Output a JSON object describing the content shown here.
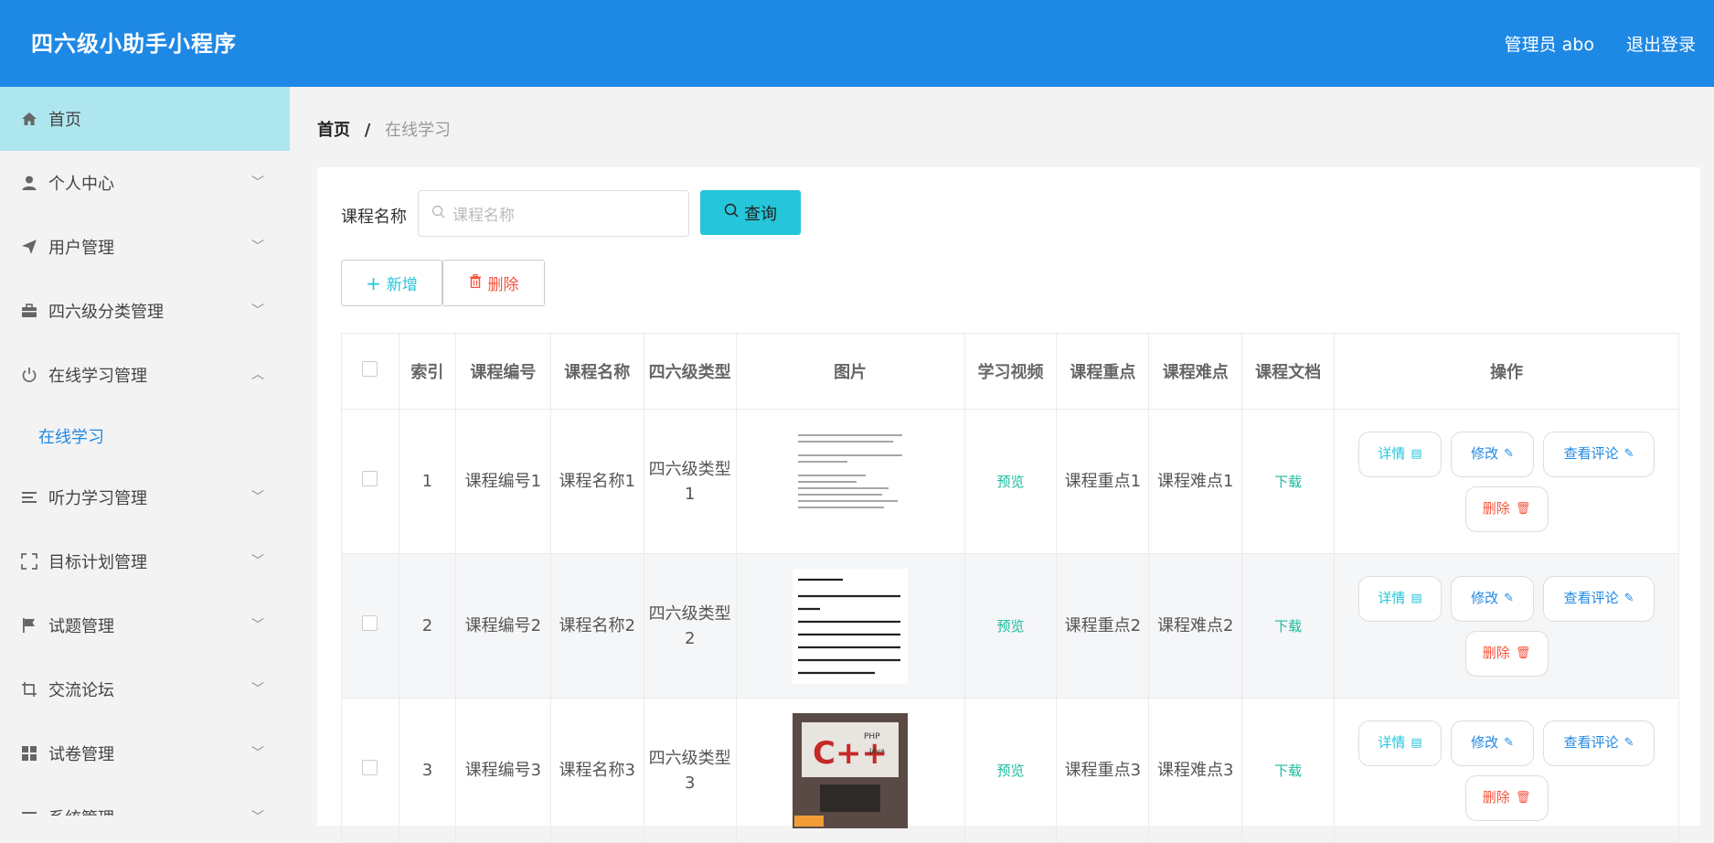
{
  "header": {
    "title": "四六级小助手小程序",
    "user": "管理员 abo",
    "logout": "退出登录"
  },
  "sidebar": {
    "items": [
      {
        "label": "首页",
        "icon": "home-icon"
      },
      {
        "label": "个人中心",
        "icon": "user-icon"
      },
      {
        "label": "用户管理",
        "icon": "send-icon"
      },
      {
        "label": "四六级分类管理",
        "icon": "briefcase-icon"
      },
      {
        "label": "在线学习管理",
        "icon": "power-icon"
      },
      {
        "label": "听力学习管理",
        "icon": "list-icon"
      },
      {
        "label": "目标计划管理",
        "icon": "fullscreen-icon"
      },
      {
        "label": "试题管理",
        "icon": "flag-icon"
      },
      {
        "label": "交流论坛",
        "icon": "crop-icon"
      },
      {
        "label": "试卷管理",
        "icon": "grid-icon"
      },
      {
        "label": "系统管理",
        "icon": "settings-icon"
      }
    ],
    "sub_online": "在线学习"
  },
  "breadcrumb": {
    "home": "首页",
    "sep": "/",
    "current": "在线学习"
  },
  "search": {
    "label": "课程名称",
    "placeholder": "课程名称",
    "button": "查询"
  },
  "actions": {
    "add": "新增",
    "delete": "删除"
  },
  "table": {
    "headers": [
      "索引",
      "课程编号",
      "课程名称",
      "四六级类型",
      "图片",
      "学习视频",
      "课程重点",
      "课程难点",
      "课程文档",
      "操作"
    ],
    "rows": [
      {
        "index": "1",
        "code": "课程编号1",
        "name": "课程名称1",
        "type": "四六级类型1",
        "video": "预览",
        "key": "课程重点1",
        "hard": "课程难点1",
        "doc": "下载"
      },
      {
        "index": "2",
        "code": "课程编号2",
        "name": "课程名称2",
        "type": "四六级类型2",
        "video": "预览",
        "key": "课程重点2",
        "hard": "课程难点2",
        "doc": "下载"
      },
      {
        "index": "3",
        "code": "课程编号3",
        "name": "课程名称3",
        "type": "四六级类型3",
        "video": "预览",
        "key": "课程重点3",
        "hard": "课程难点3",
        "doc": "下载"
      }
    ],
    "ops": {
      "detail": "详情",
      "modify": "修改",
      "comments": "查看评论",
      "remove": "删除"
    }
  },
  "colors": {
    "primary": "#1e88e5",
    "active_menu": "#aee6ef",
    "search_button": "#26c6da",
    "link_green": "#1abc9c",
    "danger": "#f5543c"
  }
}
